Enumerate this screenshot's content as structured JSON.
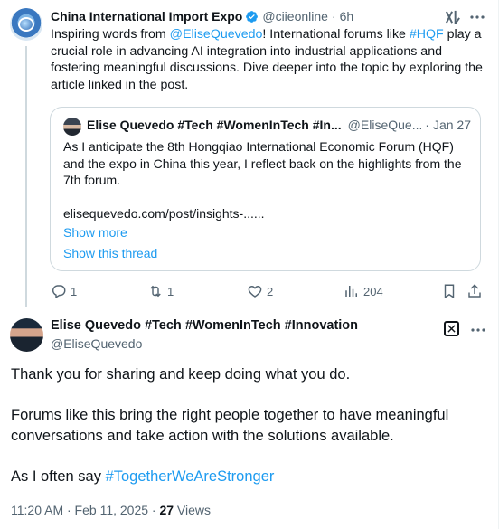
{
  "quoted_post": {
    "author_name": "China International Import Expo",
    "handle": "@ciieonline",
    "separator": "·",
    "time": "6h",
    "text_parts": {
      "t1": "Inspiring words from ",
      "mention": "@EliseQuevedo",
      "t2": "! International forums like ",
      "hashtag": "#HQF",
      "t3": " play a crucial role in advancing AI integration into industrial applications and fostering meaningful discussions. Dive deeper into the topic by exploring the article linked in the post."
    },
    "quote_card": {
      "author_name": "Elise Quevedo #Tech #WomenInTech #In...",
      "handle": "@EliseQue...",
      "separator": "·",
      "time": "Jan 27",
      "text": "As I anticipate the 8th Hongqiao International Economic Forum (HQF) and the expo in China this year, I reflect back on the highlights from the 7th forum.\n\nelisequevedo.com/post/insights-......",
      "show_more": "Show more",
      "show_thread": "Show this thread"
    },
    "actions": {
      "replies": "1",
      "reposts": "1",
      "likes": "2",
      "views": "204"
    },
    "icons": [
      "verified-badge-icon",
      "grok-icon",
      "more-icon",
      "reply-icon",
      "repost-icon",
      "like-icon",
      "views-icon",
      "bookmark-icon",
      "share-icon"
    ]
  },
  "main_post": {
    "author_name": "Elise Quevedo #Tech #WomenInTech #Innovation",
    "handle": "@EliseQuevedo",
    "paragraph1": "Thank you for sharing and keep doing what you do.",
    "paragraph2": "Forums like this bring the right people together to have meaningful conversations and take action with the solutions available.",
    "paragraph3_prefix": "As I often say ",
    "paragraph3_hashtag": "#TogetherWeAreStronger",
    "timestamp": "11:20 AM · Feb 11, 2025 · ",
    "views_count": "27",
    "views_label": " Views"
  },
  "colors": {
    "link": "#1d9bf0",
    "verified": "#1d9bf0",
    "secondary_text": "#536471",
    "border": "#cfd9de"
  }
}
